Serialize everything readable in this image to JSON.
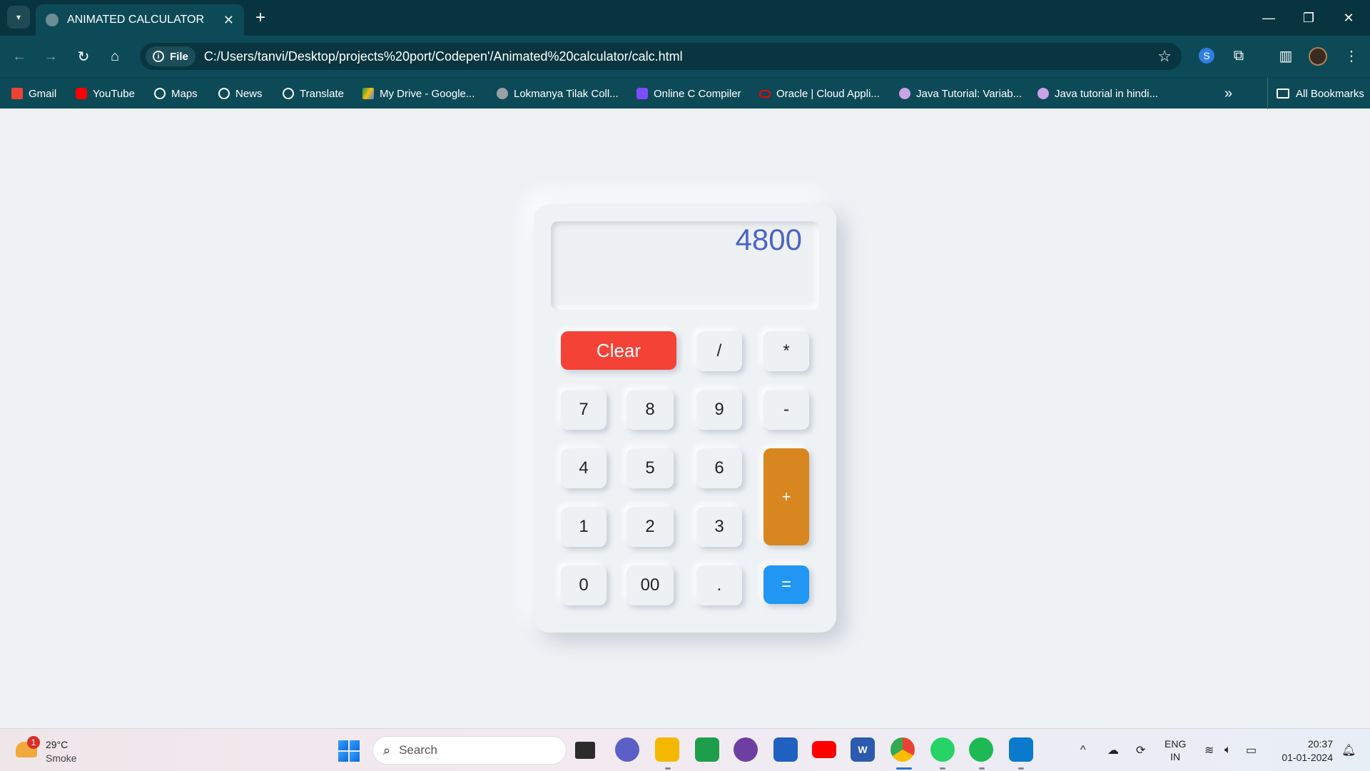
{
  "browser": {
    "tab_title": "ANIMATED CALCULATOR",
    "url_chip": "File",
    "url": "C:/Users/tanvi/Desktop/projects%20port/Codepen'/Animated%20calculator/calc.html",
    "bookmarks": [
      {
        "label": "Gmail",
        "color": "#ea4335"
      },
      {
        "label": "YouTube",
        "color": "#ff0000"
      },
      {
        "label": "Maps",
        "color": "#ffffff"
      },
      {
        "label": "News",
        "color": "#ffffff"
      },
      {
        "label": "Translate",
        "color": "#ffffff"
      },
      {
        "label": "My Drive - Google...",
        "color": "#fbbc04"
      },
      {
        "label": "Lokmanya Tilak Coll...",
        "color": "#9aa0a6"
      },
      {
        "label": "Online C Compiler",
        "color": "#7c4dff"
      },
      {
        "label": "Oracle | Cloud Appli...",
        "color": "#f80000"
      },
      {
        "label": "Java Tutorial: Variab...",
        "color": "#c9a3e6"
      },
      {
        "label": "Java tutorial in hindi...",
        "color": "#c9a3e6"
      }
    ],
    "all_bookmarks": "All Bookmarks"
  },
  "calculator": {
    "display": "4800",
    "keys": {
      "clear": "Clear",
      "divide": "/",
      "multiply": "*",
      "seven": "7",
      "eight": "8",
      "nine": "9",
      "minus": "-",
      "four": "4",
      "five": "5",
      "six": "6",
      "plus": "+",
      "one": "1",
      "two": "2",
      "three": "3",
      "zero": "0",
      "double_zero": "00",
      "decimal": ".",
      "equals": "="
    },
    "colors": {
      "clear": "#f44336",
      "plus": "#d8861f",
      "equals": "#2196f3",
      "display_text": "#4e63c6"
    }
  },
  "taskbar": {
    "weather": {
      "badge": "1",
      "temp": "29°C",
      "condition": "Smoke"
    },
    "search_placeholder": "Search",
    "language": {
      "line1": "ENG",
      "line2": "IN"
    },
    "time": "20:37",
    "date": "01-01-2024"
  }
}
